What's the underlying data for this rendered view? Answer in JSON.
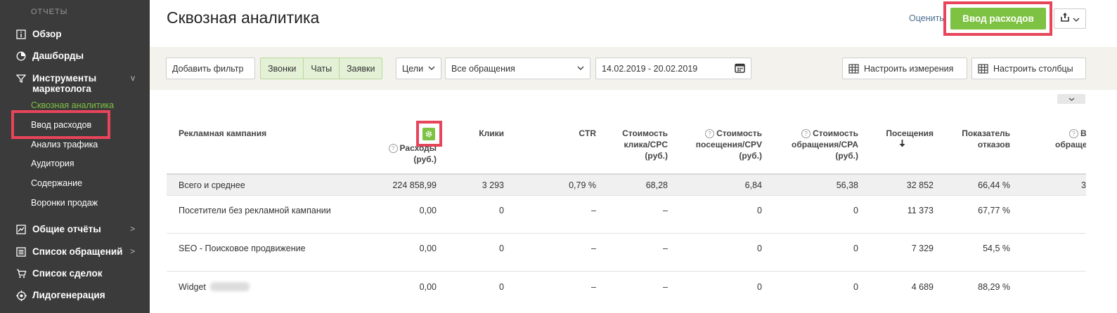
{
  "sidebar": {
    "section": "ОТЧЕТЫ",
    "items": [
      {
        "label": "Обзор",
        "icon": "info-icon"
      },
      {
        "label": "Дашборды",
        "icon": "pie-icon"
      },
      {
        "label": "Инструменты маркетолога",
        "icon": "funnel-icon",
        "arrow": "v"
      },
      {
        "label": "Общие отчёты",
        "icon": "chart-icon",
        "arrow": ">"
      },
      {
        "label": "Список обращений",
        "icon": "list-icon",
        "arrow": ">"
      },
      {
        "label": "Список сделок",
        "icon": "cart-icon"
      },
      {
        "label": "Лидогенерация",
        "icon": "target-icon"
      }
    ],
    "subitems": [
      "Сквозная аналитика",
      "Ввод расходов",
      "Анализ трафика",
      "Аудитория",
      "Содержание",
      "Воронки продаж"
    ]
  },
  "header": {
    "title": "Сквозная аналитика",
    "rate_link": "Оценить",
    "primary_button": "Ввод расходов"
  },
  "filters": {
    "add_filter": "Добавить фильтр",
    "segments": [
      "Звонки",
      "Чаты",
      "Заявки"
    ],
    "goals": "Цели",
    "requests": "Все обращения",
    "date_range": "14.02.2019 - 20.02.2019",
    "configure_dimensions": "Настроить измерения",
    "configure_columns": "Настроить столбцы"
  },
  "table": {
    "headers": {
      "campaign": "Рекламная кампания",
      "expenses_1": "Расходы",
      "expenses_2": "(руб.)",
      "clicks": "Клики",
      "ctr": "CTR",
      "cpc_1": "Стоимость",
      "cpc_2": "клика/CPC",
      "cpc_3": "(руб.)",
      "cpv_1": "Стоимость",
      "cpv_2": "посещения/CPV",
      "cpv_3": "(руб.)",
      "cpa_1": "Стоимость",
      "cpa_2": "обращения/CPA",
      "cpa_3": "(руб.)",
      "visits": "Посещения",
      "bounce_1": "Показатель",
      "bounce_2": "отказов",
      "cut_1": "В",
      "cut_2": "обраще"
    },
    "rows": [
      {
        "name": "Всего и среднее",
        "expenses": "224 858,99",
        "clicks": "3 293",
        "ctr": "0,79 %",
        "cpc": "68,28",
        "cpv": "6,84",
        "cpa": "56,38",
        "visits": "32 852",
        "bounce": "66,44 %",
        "cut": "3"
      },
      {
        "name": "Посетители без рекламной кампании",
        "expenses": "0,00",
        "clicks": "0",
        "ctr": "–",
        "cpc": "–",
        "cpv": "0",
        "cpa": "0",
        "visits": "11 373",
        "bounce": "67,77 %",
        "cut": ""
      },
      {
        "name": "SEO - Поисковое продвижение",
        "expenses": "0,00",
        "clicks": "0",
        "ctr": "–",
        "cpc": "–",
        "cpv": "0",
        "cpa": "0",
        "visits": "7 329",
        "bounce": "54,5 %",
        "cut": ""
      },
      {
        "name": "Widget",
        "expenses": "0,00",
        "clicks": "0",
        "ctr": "–",
        "cpc": "–",
        "cpv": "0",
        "cpa": "0",
        "visits": "4 689",
        "bounce": "88,29 %",
        "cut": ""
      }
    ]
  },
  "colors": {
    "accent_green": "#7dc242",
    "highlight_red": "#e8445a",
    "sidebar_bg": "#3b3b3b"
  }
}
